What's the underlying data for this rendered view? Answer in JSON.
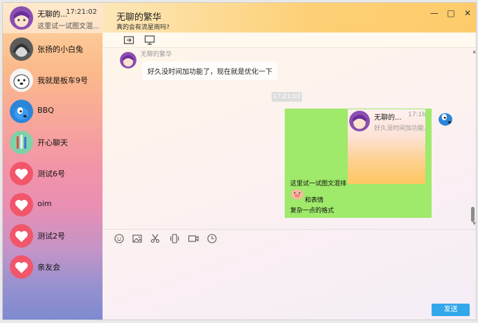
{
  "contacts": [
    {
      "name": "无聊的...",
      "time": "17:21:02",
      "preview": "这里试一试图文混...",
      "avatar": "anime-girl-avatar",
      "active": true
    },
    {
      "name": "张扬的小白兔",
      "avatar": "hooded-figure-avatar"
    },
    {
      "name": "我就是板车9号",
      "avatar": "white-dog-avatar"
    },
    {
      "name": "BBQ",
      "avatar": "blue-dog-avatar"
    },
    {
      "name": "开心聊天",
      "avatar": "pencils-avatar"
    },
    {
      "name": "测试6号",
      "avatar": "heart-avatar"
    },
    {
      "name": "oim",
      "avatar": "heart-avatar"
    },
    {
      "name": "测试2号",
      "avatar": "heart-avatar"
    },
    {
      "name": "亲友会",
      "avatar": "heart-avatar"
    }
  ],
  "header": {
    "title": "无聊的繁华",
    "subtitle": "真的会有流星雨吗?"
  },
  "window_controls": {
    "minimize": "—",
    "maximize": "□",
    "close": "✕"
  },
  "chat": {
    "incoming": {
      "sender": "无聊的繁华",
      "text": "好久没时间加功能了，现在就是优化一下"
    },
    "timestamp": "17:21:02",
    "outgoing": {
      "card": {
        "name": "无聊的...",
        "time": "17:1b:",
        "preview": "好久没时间加功能..."
      },
      "line1": "这里试一试图文混排",
      "line2": "和表情",
      "line3": "复杂一点的格式"
    }
  },
  "composer": {
    "tools": [
      "emoji-icon",
      "image-icon",
      "scissors-icon",
      "vibrate-icon",
      "video-icon",
      "clock-icon"
    ]
  },
  "send_label": "发送",
  "colors": {
    "accent": "#32a7ea",
    "outgoing_bubble": "#9fe96b",
    "header": "#fdd077"
  }
}
